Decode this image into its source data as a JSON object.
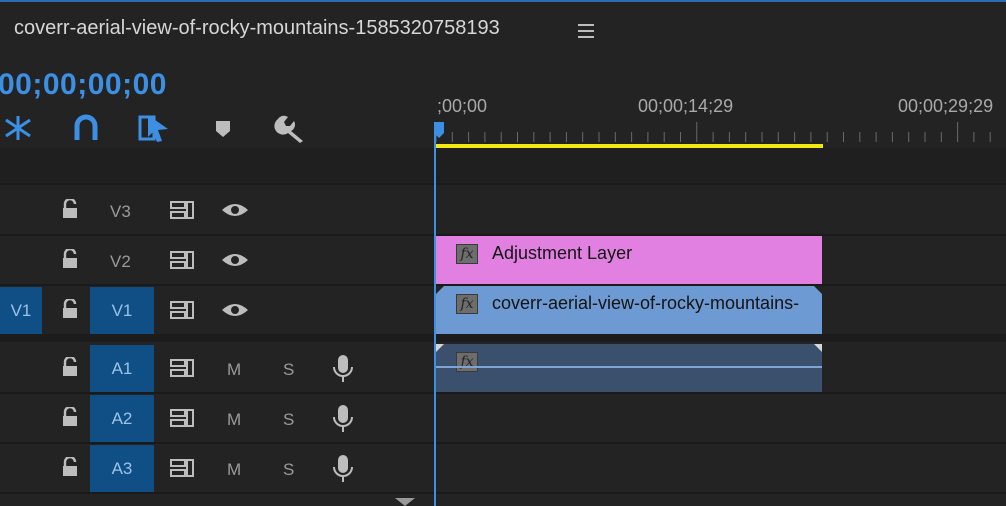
{
  "sequence": {
    "title": "coverr-aerial-view-of-rocky-mountains-1585320758193"
  },
  "timecode": "00;00;00;00",
  "toolbar": {
    "tools": [
      "insert-overwrite-icon",
      "snap-magnet-icon",
      "linked-selection-icon",
      "add-marker-icon",
      "wrench-settings-icon"
    ]
  },
  "ruler": {
    "labels": [
      ";00;00",
      "00;00;14;29",
      "00;00;29;29"
    ]
  },
  "tracks": {
    "video": [
      {
        "target": "",
        "label": "V3",
        "visible": true
      },
      {
        "target": "",
        "label": "V2",
        "visible": true
      },
      {
        "target": "V1",
        "label": "V1",
        "visible": true
      }
    ],
    "audio": [
      {
        "label": "A1",
        "mute": "M",
        "solo": "S"
      },
      {
        "label": "A2",
        "mute": "M",
        "solo": "S"
      },
      {
        "label": "A3",
        "mute": "M",
        "solo": "S"
      }
    ]
  },
  "clips": {
    "adjustment": {
      "fx": "fx",
      "name": "Adjustment Layer",
      "color": "#e180e0"
    },
    "video": {
      "fx": "fx",
      "name": "coverr-aerial-view-of-rocky-mountains-",
      "color": "#6e9ad3"
    },
    "audio": {
      "fx": "fx",
      "color": "#3b506c"
    }
  },
  "colors": {
    "accent": "#3d8fe3",
    "work_area": "#f3e810",
    "patch": "#0f4f86"
  }
}
